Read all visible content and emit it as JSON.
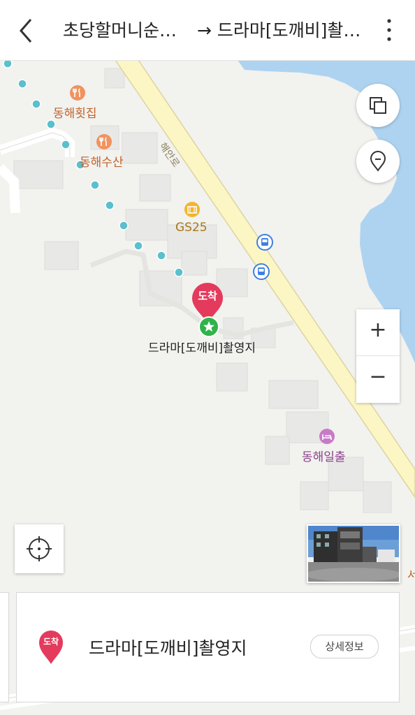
{
  "header": {
    "from_title": "초당할머니순…",
    "arrow": "→",
    "to_title": "드라마[도깨비]촬…"
  },
  "map": {
    "road_label": "해안로",
    "pois": [
      {
        "label": "동해횟집",
        "icon": "restaurant-icon"
      },
      {
        "label": "동해수산",
        "icon": "restaurant-icon"
      },
      {
        "label": "GS25",
        "icon": "convenience-store-icon"
      },
      {
        "label": "동해일출",
        "icon": "lodging-icon"
      }
    ],
    "destination_badge": "도착",
    "destination_label": "드라마[도깨비]촬영지",
    "edge_label": "서",
    "colors": {
      "water": "#aed3f1",
      "road": "#fcf6c4",
      "road_edge": "#ddd4a0",
      "route_dot": "#5bbfcc",
      "dest_pin": "#e43a5c",
      "poi_food": "#f0935f",
      "poi_store": "#f2b52d",
      "poi_lodging": "#c77bc7",
      "bus": "#3f7fe0"
    }
  },
  "controls": {
    "zoom_in": "+",
    "zoom_out": "−"
  },
  "card": {
    "badge": "도착",
    "name": "드라마[도깨비]촬영지",
    "detail_button": "상세정보"
  }
}
